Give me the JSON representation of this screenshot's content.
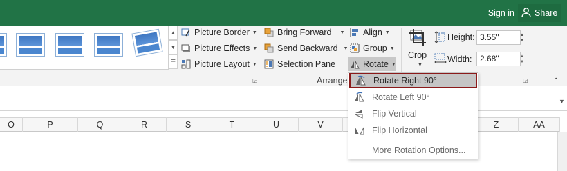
{
  "titlebar": {
    "sign_in": "Sign in",
    "share": "Share"
  },
  "arrange_group": {
    "label": "Arrange",
    "bring_forward": "Bring Forward",
    "send_backward": "Send Backward",
    "selection_pane": "Selection Pane",
    "align": "Align",
    "group": "Group",
    "rotate": "Rotate"
  },
  "picture_styles": {
    "picture_border": "Picture Border",
    "picture_effects": "Picture Effects",
    "picture_layout": "Picture Layout"
  },
  "size_group": {
    "crop": "Crop",
    "height_label": "Height:",
    "height_value": "3.55\"",
    "width_label": "Width:",
    "width_value": "2.68\""
  },
  "columns": [
    "O",
    "P",
    "Q",
    "R",
    "S",
    "T",
    "U",
    "V",
    "Z",
    "AA"
  ],
  "rotate_menu": {
    "items": [
      {
        "label": "Rotate Right 90°",
        "icon": "rotate-right-icon",
        "highlighted": true
      },
      {
        "label": "Rotate Left 90°",
        "icon": "rotate-left-icon"
      },
      {
        "label": "Flip Vertical",
        "icon": "flip-vertical-icon"
      },
      {
        "label": "Flip Horizontal",
        "icon": "flip-horizontal-icon"
      },
      {
        "label": "More Rotation Options...",
        "icon": ""
      }
    ]
  },
  "colors": {
    "title_bar": "#217346",
    "highlight_border": "#8b1a1a"
  }
}
